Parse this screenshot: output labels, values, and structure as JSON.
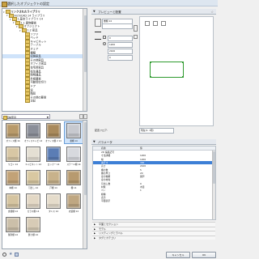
{
  "window": {
    "title": "選択したオブジェクトの設定"
  },
  "tree": {
    "items": [
      {
        "label": "リンクされたライブラリ",
        "indent": 0,
        "expanded": true,
        "bold": true
      },
      {
        "label": "ArchiCAD 14 ライブラリ",
        "indent": 1,
        "expanded": true
      },
      {
        "label": "1.基本ライブラリ 14",
        "indent": 2,
        "expanded": true
      },
      {
        "label": "1.1 建物要素",
        "indent": 3,
        "expanded": true
      },
      {
        "label": "オブジェクト",
        "indent": 4,
        "expanded": true
      },
      {
        "label": "1.2 家具",
        "indent": 5,
        "expanded": true
      },
      {
        "label": "ソファ",
        "indent": 6
      },
      {
        "label": "ベッド",
        "indent": 6
      },
      {
        "label": "キャビネット",
        "indent": 6
      },
      {
        "label": "テーブル",
        "indent": 6
      },
      {
        "label": "チェア",
        "indent": 6
      },
      {
        "label": "棚類",
        "indent": 6
      },
      {
        "label": "収納家具",
        "indent": 6
      },
      {
        "label": "その他家具",
        "indent": 6
      },
      {
        "label": "オフィス家具",
        "indent": 6
      },
      {
        "label": "住宅用家具",
        "indent": 6
      },
      {
        "label": "衛生器具",
        "indent": 6
      },
      {
        "label": "照明器具",
        "indent": 6
      },
      {
        "label": "外構要素",
        "indent": 6
      },
      {
        "label": "可動間仕切り",
        "indent": 6
      },
      {
        "label": "ドア",
        "indent": 6
      },
      {
        "label": "窓",
        "indent": 6
      },
      {
        "label": "階段",
        "indent": 6
      },
      {
        "label": "その他の要素",
        "indent": 6
      },
      {
        "label": "注記",
        "indent": 6
      }
    ],
    "selected_index": 12
  },
  "gallery": {
    "folder_select": "収納家具",
    "items": [
      {
        "label": "オフィス棚 14",
        "color": "#b89a6a",
        "selected": false
      },
      {
        "label": "オフィスキャビ 14",
        "color": "#8b8f99",
        "selected": false
      },
      {
        "label": "オフィス棚 2 14",
        "color": "#a98a5c",
        "selected": false
      },
      {
        "label": "書棚 14",
        "color": "#c7c9cf",
        "selected": true
      },
      {
        "label": "ワゴン 14",
        "color": "#d8c7a4",
        "selected": false
      },
      {
        "label": "キャビネット 14",
        "color": "#e4dfd3",
        "selected": false
      },
      {
        "label": "ロッカー 14",
        "color": "#5b7db5",
        "selected": false
      },
      {
        "label": "スチール棚 14",
        "color": "#d7d9de",
        "selected": false
      },
      {
        "label": "本棚 14",
        "color": "#c2a277",
        "selected": false
      },
      {
        "label": "引出し 14",
        "color": "#d9c8a1",
        "selected": false
      },
      {
        "label": "戸棚 14",
        "color": "#c8b28b",
        "selected": false
      },
      {
        "label": "棚 14",
        "color": "#b79a6f",
        "selected": false
      },
      {
        "label": "食器棚 14",
        "color": "#d5c4a0",
        "selected": false
      },
      {
        "label": "ガラス棚 14",
        "color": "#e3d8c5",
        "selected": false
      },
      {
        "label": "タンス 14",
        "color": "#e5dccb",
        "selected": false
      },
      {
        "label": "衣装棚 14",
        "color": "#bfa782",
        "selected": false
      },
      {
        "label": "陳列棚 14",
        "color": "#cbbfa9",
        "selected": false
      },
      {
        "label": "飾り棚 14",
        "color": "#d7cbb6",
        "selected": false
      }
    ]
  },
  "preview": {
    "header": "プレビューと配置",
    "category": "書棚 14",
    "fields": [
      "0",
      "1200",
      "2100",
      "0"
    ],
    "layer_label": "配置フロア:",
    "floor_select": "現在(1. 1階)"
  },
  "params": {
    "header": "パラメータ",
    "col_name": "名前",
    "col_value": "値",
    "rows": [
      {
        "name": "2D 編集記号",
        "value": ""
      },
      {
        "name": "寸法詳細",
        "value": "1200"
      },
      {
        "name": "幅",
        "value": "1200"
      },
      {
        "name": "奥行き",
        "value": "400"
      },
      {
        "name": "高さ",
        "value": "2100"
      },
      {
        "name": "棚の数",
        "value": "5"
      },
      {
        "name": "棚の厚さ",
        "value": "20"
      },
      {
        "name": "扉の種類",
        "value": "開戸"
      },
      {
        "name": "扉の材質",
        "value": ""
      },
      {
        "name": "引出し数",
        "value": "0"
      },
      {
        "name": "材質",
        "value": "木目"
      },
      {
        "name": "ペン",
        "value": "1"
      },
      {
        "name": "線種",
        "value": ""
      },
      {
        "name": "表示",
        "value": ""
      },
      {
        "name": "平面表示",
        "value": ""
      }
    ],
    "selected_index": 3
  },
  "sections": [
    "平面とセクション",
    "モデル",
    "リスティングとラベル",
    "タグとカテゴリ"
  ],
  "footer": {
    "cancel": "キャンセル",
    "ok": "OK"
  }
}
